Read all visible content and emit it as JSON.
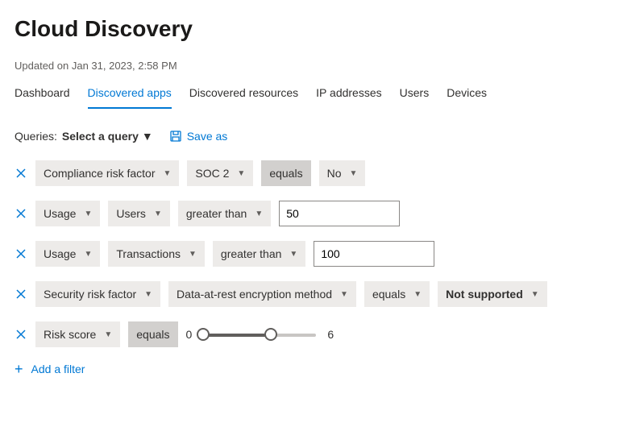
{
  "header": {
    "title": "Cloud Discovery",
    "updated": "Updated on Jan 31, 2023, 2:58 PM"
  },
  "tabs": [
    {
      "label": "Dashboard",
      "active": false
    },
    {
      "label": "Discovered apps",
      "active": true
    },
    {
      "label": "Discovered resources",
      "active": false
    },
    {
      "label": "IP addresses",
      "active": false
    },
    {
      "label": "Users",
      "active": false
    },
    {
      "label": "Devices",
      "active": false
    }
  ],
  "queries": {
    "label": "Queries:",
    "select_label": "Select a query",
    "save_as": "Save as"
  },
  "filters": [
    {
      "field": "Compliance risk factor",
      "subfield": "SOC 2",
      "operator": "equals",
      "value_chip": "No",
      "op_dark": true
    },
    {
      "field": "Usage",
      "subfield": "Users",
      "operator": "greater than",
      "value_input": "50"
    },
    {
      "field": "Usage",
      "subfield": "Transactions",
      "operator": "greater than",
      "value_input": "100"
    },
    {
      "field": "Security risk factor",
      "subfield": "Data-at-rest encryption method",
      "operator": "equals",
      "value_chip": "Not supported",
      "value_bold": true
    },
    {
      "field": "Risk score",
      "operator": "equals",
      "slider": {
        "min": 0,
        "max": 6,
        "range_max": 10
      },
      "op_dark": true
    }
  ],
  "add_filter": "Add a filter"
}
